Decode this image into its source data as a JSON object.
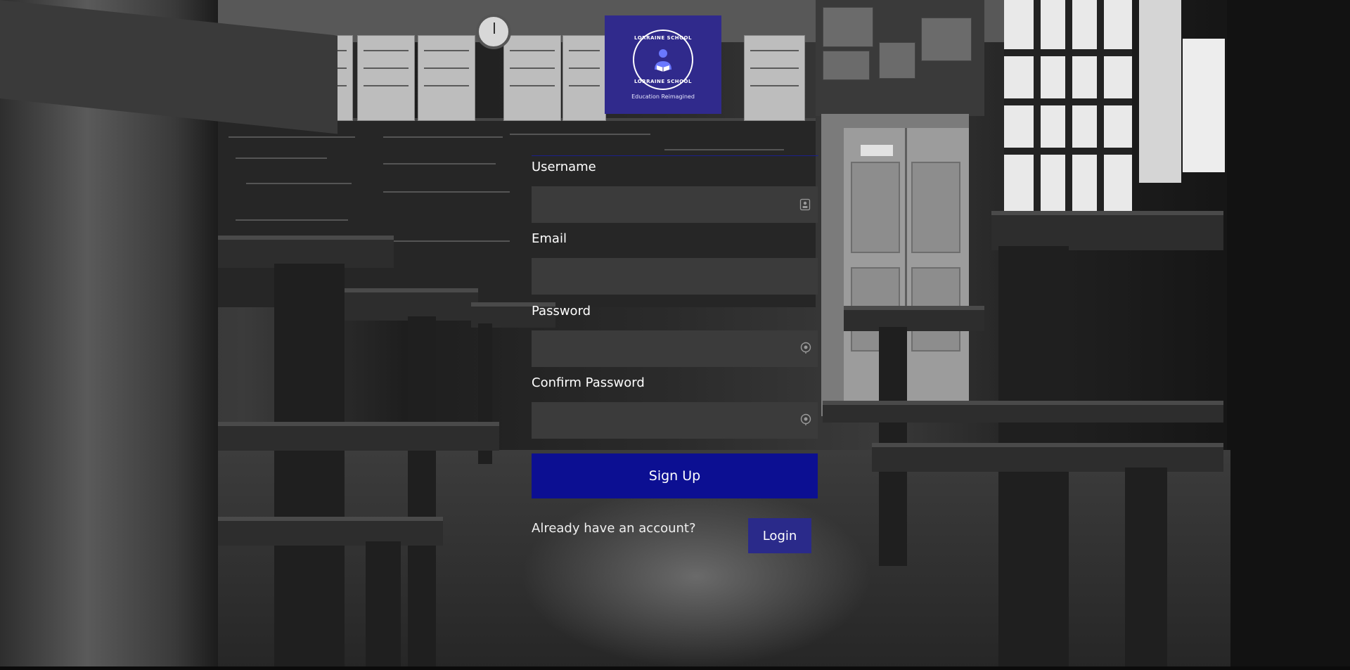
{
  "logo": {
    "school_name": "LORRAINE SCHOOL",
    "tagline": "Education Reimagined",
    "icon": "reading-student-icon",
    "color": "#302a8c"
  },
  "form": {
    "username_label": "Username",
    "email_label": "Email",
    "password_label": "Password",
    "confirm_password_label": "Confirm Password",
    "username_value": "",
    "email_value": "",
    "password_value": "",
    "confirm_password_value": "",
    "username_icon": "contact-card-icon",
    "password_icon": "password-reveal-icon",
    "confirm_password_icon": "password-reveal-icon",
    "field_color": "#3b3b3b"
  },
  "actions": {
    "signup_label": "Sign Up",
    "signup_color": "#0c0f92",
    "account_prompt": "Already have an account?",
    "login_label": "Login",
    "login_color": "#2a2a8a"
  }
}
